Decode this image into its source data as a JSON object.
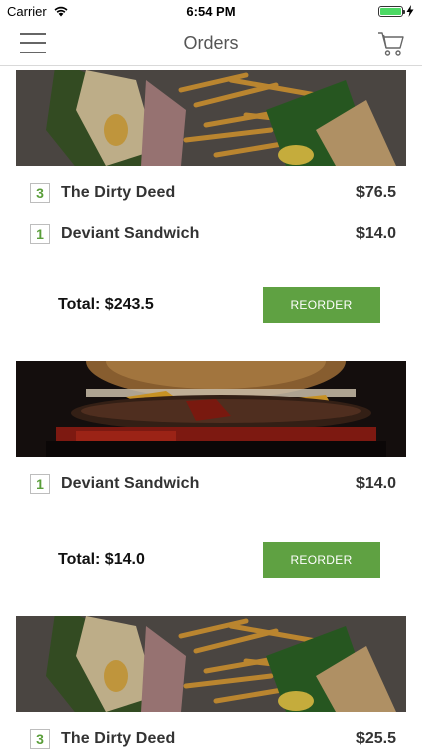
{
  "status_bar": {
    "carrier": "Carrier",
    "time": "6:54 PM"
  },
  "header": {
    "title": "Orders",
    "menu_icon": "hamburger-menu-icon",
    "cart_icon": "shopping-cart-icon"
  },
  "colors": {
    "accent_green": "#5fa142",
    "quantity_green": "#5a9e3a",
    "text_dark": "#333333"
  },
  "orders": [
    {
      "image": "sandwich-fries-photo",
      "items": [
        {
          "qty": "3",
          "name": "The Dirty Deed",
          "price": "$76.5"
        },
        {
          "qty": "1",
          "name": "Deviant Sandwich",
          "price": "$14.0"
        }
      ],
      "total": "Total: $243.5",
      "reorder_label": "REORDER"
    },
    {
      "image": "burger-photo",
      "items": [
        {
          "qty": "1",
          "name": "Deviant Sandwich",
          "price": "$14.0"
        }
      ],
      "total": "Total: $14.0",
      "reorder_label": "REORDER"
    },
    {
      "image": "sandwich-fries-photo",
      "items": [
        {
          "qty": "3",
          "name": "The Dirty Deed",
          "price": "$25.5"
        }
      ]
    }
  ]
}
